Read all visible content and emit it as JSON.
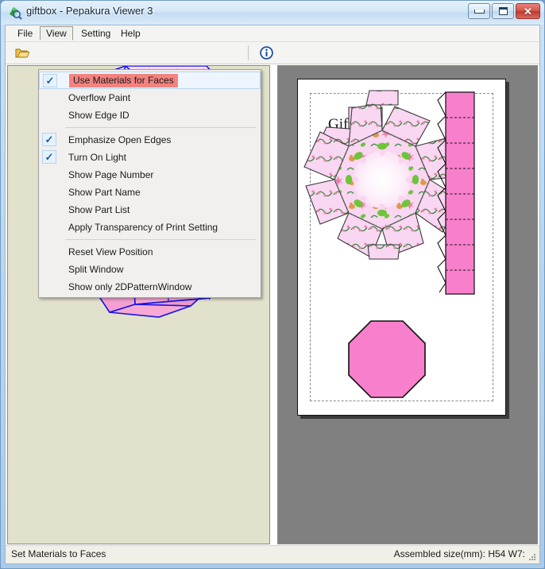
{
  "window": {
    "title": "giftbox - Pepakura Viewer 3",
    "app_icon": "pepakura-app-icon",
    "buttons": {
      "minimize": "minimize-icon",
      "maximize": "maximize-icon",
      "close": "close-icon"
    }
  },
  "menubar": {
    "items": [
      {
        "label": "File",
        "active": false
      },
      {
        "label": "View",
        "active": true
      },
      {
        "label": "Setting",
        "active": false
      },
      {
        "label": "Help",
        "active": false
      }
    ]
  },
  "toolbar": {
    "open_icon": "folder-open-icon",
    "info_icon": "info-icon"
  },
  "view_menu": {
    "items": [
      {
        "label": "Use Materials for Faces",
        "checked": true,
        "highlighted": true,
        "separator_after": false
      },
      {
        "label": "Overflow Paint",
        "checked": false,
        "highlighted": false,
        "separator_after": false
      },
      {
        "label": "Show Edge ID",
        "checked": false,
        "highlighted": false,
        "separator_after": true
      },
      {
        "label": "Emphasize Open Edges",
        "checked": true,
        "highlighted": false,
        "separator_after": false
      },
      {
        "label": "Turn On Light",
        "checked": true,
        "highlighted": false,
        "separator_after": false
      },
      {
        "label": "Show Page Number",
        "checked": false,
        "highlighted": false,
        "separator_after": false
      },
      {
        "label": "Show Part Name",
        "checked": false,
        "highlighted": false,
        "separator_after": false
      },
      {
        "label": "Show Part List",
        "checked": false,
        "highlighted": false,
        "separator_after": false
      },
      {
        "label": "Apply Transparency of Print Setting",
        "checked": false,
        "highlighted": false,
        "separator_after": true
      },
      {
        "label": "Reset View Position",
        "checked": false,
        "highlighted": false,
        "separator_after": false
      },
      {
        "label": "Split Window",
        "checked": false,
        "highlighted": false,
        "separator_after": false
      },
      {
        "label": "Show only 2DPatternWindow",
        "checked": false,
        "highlighted": false,
        "separator_after": false
      }
    ],
    "check_glyph": "✓"
  },
  "view3d": {
    "name": "3d-model-view",
    "background": "#e2e1cb",
    "model": "octagonal gift box with lid",
    "edge_color": "#1414e6",
    "open_edge_color": "#e01010",
    "body_color": "#f8a0cf",
    "lid_color": "#fbd9f2",
    "interior_color": "#808080"
  },
  "view2d": {
    "name": "2d-pattern-view",
    "background": "#808080",
    "sheet_title": "Gift Box",
    "paper_color": "#ffffff",
    "part_fill": "#f87fcb",
    "lid_fill": "#f9d7f1"
  },
  "statusbar": {
    "left_text": "Set Materials to Faces",
    "right_text": "Assembled size(mm): H54 W7:",
    "grip_icon": "resize-grip-icon"
  }
}
